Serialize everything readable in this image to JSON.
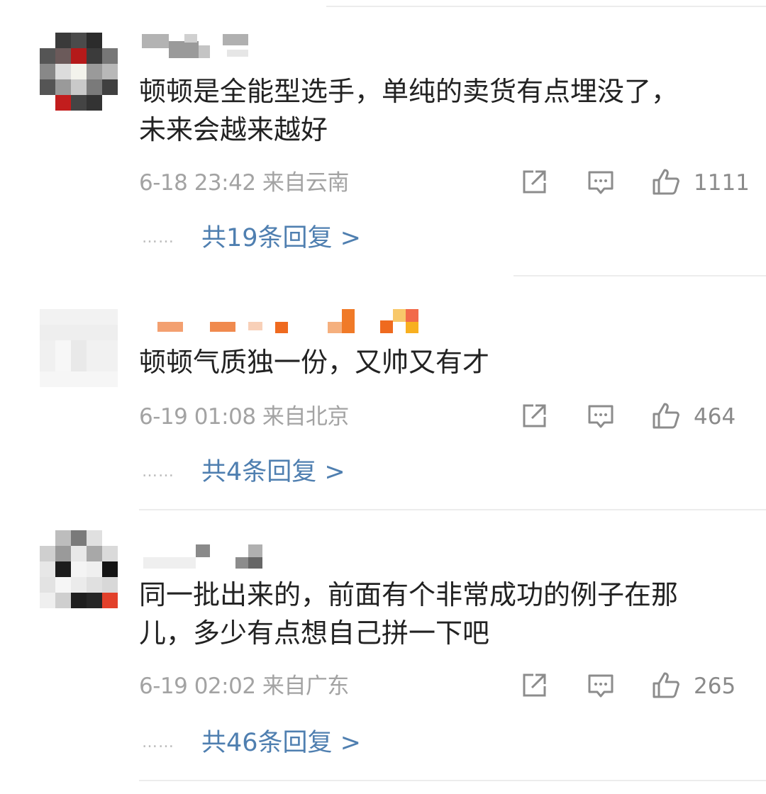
{
  "comments": [
    {
      "text": "顿顿是全能型选手，单纯的卖货有点埋没了，\n未来会越来越好",
      "date": "6-18 23:42",
      "location": "来自云南",
      "likes": "1111",
      "replies_label": "共19条回复 >",
      "dots": "……"
    },
    {
      "text": "顿顿气质独一份，又帅又有才",
      "date": "6-19 01:08",
      "location": "来自北京",
      "likes": "464",
      "replies_label": "共4条回复 >",
      "dots": "……"
    },
    {
      "text": "同一批出来的，前面有个非常成功的例子在那\n儿，多少有点想自己拼一下吧",
      "date": "6-19 02:02",
      "location": "来自广东",
      "likes": "265",
      "replies_label": "共46条回复 >",
      "dots": "……"
    }
  ],
  "icons": [
    "share-icon",
    "comment-icon",
    "like-icon"
  ],
  "colors": {
    "text": "#222222",
    "meta": "#a3a3a3",
    "link": "#4f7fb0",
    "divider": "#ececec"
  }
}
